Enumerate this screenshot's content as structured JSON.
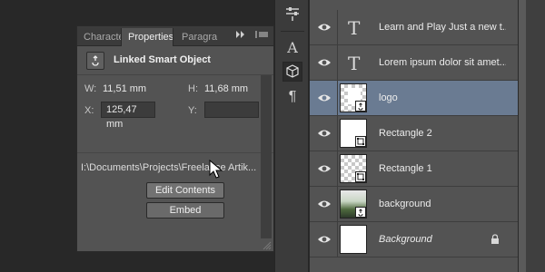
{
  "properties_panel": {
    "tabs": [
      {
        "label": "Characte",
        "active": false
      },
      {
        "label": "Properties",
        "active": true
      },
      {
        "label": "Paragra",
        "active": false
      }
    ],
    "object_type": "Linked Smart Object",
    "width_label": "W:",
    "width_value": "11,51 mm",
    "height_label": "H:",
    "height_value": "11,68 mm",
    "x_label": "X:",
    "x_value": "125,47 mm",
    "y_label": "Y:",
    "y_value": "",
    "file_path": "I:\\Documents\\Projects\\Freelance Artik...",
    "edit_contents_label": "Edit Contents",
    "embed_label": "Embed"
  },
  "tool_strip": {
    "icons": [
      "adjustments-sliders-icon",
      "character-icon",
      "3d-cube-icon",
      "paragraph-icon"
    ]
  },
  "layers": [
    {
      "name": "Learn and Play Just a new t...",
      "kind": "text",
      "selected": false,
      "visible": true
    },
    {
      "name": "Lorem ipsum dolor sit amet...",
      "kind": "text",
      "selected": false,
      "visible": true
    },
    {
      "name": "logo",
      "kind": "smart-object",
      "selected": true,
      "visible": true
    },
    {
      "name": "Rectangle 2",
      "kind": "shape",
      "selected": false,
      "visible": true
    },
    {
      "name": "Rectangle 1",
      "kind": "shape",
      "selected": false,
      "visible": true
    },
    {
      "name": "background",
      "kind": "smart-object-photo",
      "selected": false,
      "visible": true
    },
    {
      "name": "Background",
      "kind": "locked-background",
      "selected": false,
      "visible": true,
      "locked": true
    }
  ],
  "colors": {
    "panel_bg": "#535353",
    "dark_bg": "#282828",
    "selected_layer": "#6a7b92"
  }
}
